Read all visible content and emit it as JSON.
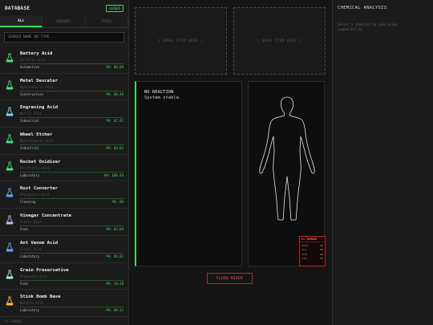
{
  "left_panel": {
    "title": "DATABASE",
    "badge": "LOADED",
    "tabs": [
      {
        "label": "ALL",
        "active": true
      },
      {
        "label": "ORGANIC",
        "active": false
      },
      {
        "label": "TYPES",
        "active": false
      }
    ],
    "search_placeholder": "SEARCH NAME OR TYPE...",
    "items": [
      {
        "name": "Battery Acid",
        "chemical": "Sulfuric Acid",
        "category": "Automotive",
        "ph": "PH: 00.08",
        "flask_color": "#4ade80"
      },
      {
        "name": "Metal Descaler",
        "chemical": "Hydrochloric Acid",
        "category": "Construction",
        "ph": "PH: 00.48",
        "flask_color": "#4ade80"
      },
      {
        "name": "Engraving Acid",
        "chemical": "Nitric Acid",
        "category": "Industrial",
        "ph": "PH: 01.01",
        "flask_color": "#7dd3fc"
      },
      {
        "name": "Wheel Etcher",
        "chemical": "Hydrofluoric Acid",
        "category": "Industrial",
        "ph": "PH: 03.03",
        "flask_color": "#4ade80"
      },
      {
        "name": "Rocket Oxidizer",
        "chemical": "Perchloric Acid",
        "category": "Laboratory",
        "ph": "PH: 100.49",
        "flask_color": "#4ade80"
      },
      {
        "name": "Rust Converter",
        "chemical": "Phosphoric Acid",
        "category": "Cleaning",
        "ph": "PH: 08",
        "flask_color": "#60a5fa"
      },
      {
        "name": "Vinegar Concentrate",
        "chemical": "Acetic Acid",
        "category": "Food",
        "ph": "PH: 03.09",
        "flask_color": "#c4b5fd"
      },
      {
        "name": "Ant Venom Acid",
        "chemical": "Formic Acid",
        "category": "Laboratory",
        "ph": "PH: 06.03",
        "flask_color": "#60a5fa"
      },
      {
        "name": "Grain Preservative",
        "chemical": "Propionic Acid",
        "category": "Food",
        "ph": "PH: 78.28",
        "flask_color": "#a7f3d0"
      },
      {
        "name": "Stink Bomb Base",
        "chemical": "Butyric Acid",
        "category": "Laboratory",
        "ph": "PH: 09.11",
        "flask_color": "#fbbf24"
      }
    ],
    "footer": "v1.0PNNAL"
  },
  "drop_zones": [
    "[ DRAG ITEM HERE ]",
    "[ DRAG ITEM HERE ]"
  ],
  "reaction": {
    "title": "NO REACTION",
    "text": "System stable."
  },
  "vitals": {
    "title": "0% DAMAGE",
    "rows": [
      {
        "label": "HEART",
        "value": "OK"
      },
      {
        "label": "CELL",
        "value": "OK"
      },
      {
        "label": "SKIN",
        "value": "OK"
      },
      {
        "label": "LUNG",
        "value": "OK"
      }
    ]
  },
  "flush_button": "FLUSH MIXER",
  "right_panel": {
    "title": "CHEMICAL ANALYSIS",
    "hint": "Select a chemical to view props compatibility..."
  },
  "colors": {
    "accent": "#3ddc5c",
    "danger": "#ff5c5c"
  }
}
